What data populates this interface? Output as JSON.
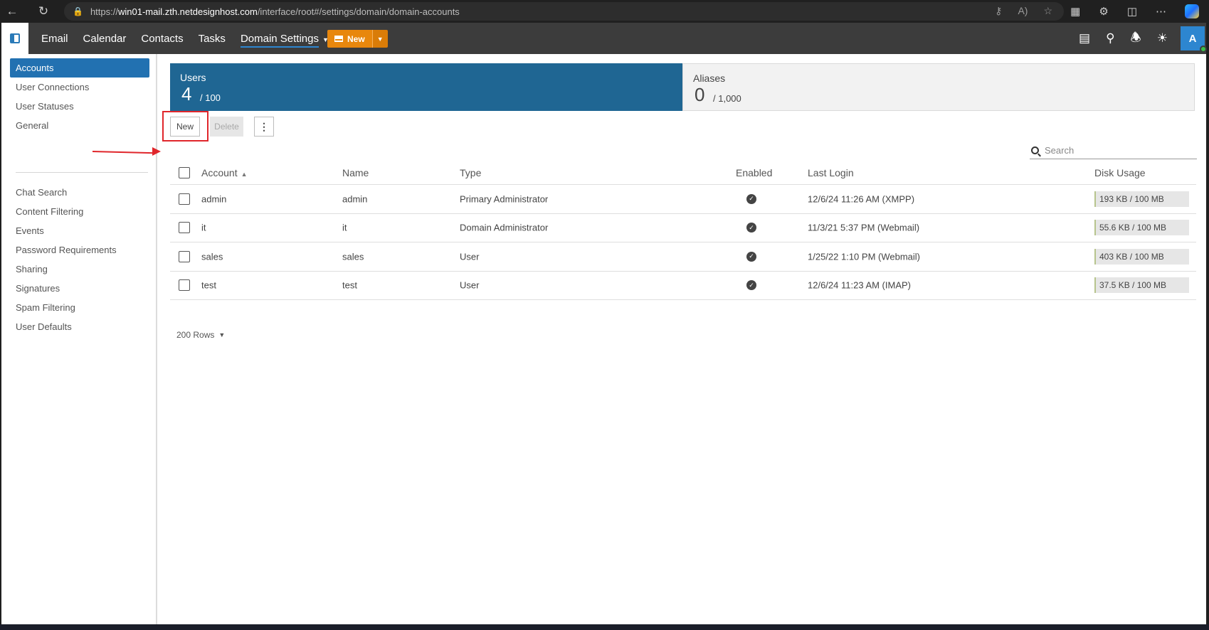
{
  "browser": {
    "url_prefix": "https://",
    "url_host": "win01-mail.zth.netdesignhost.com",
    "url_path": "/interface/root#/settings/domain/domain-accounts"
  },
  "topnav": {
    "links": [
      "Email",
      "Calendar",
      "Contacts",
      "Tasks"
    ],
    "active_link": "Domain Settings",
    "new_button": "New",
    "avatar_initial": "A"
  },
  "sidebar": {
    "items": [
      "Accounts",
      "User Connections",
      "User Statuses",
      "General",
      "Chat Search",
      "Content Filtering",
      "Events",
      "Password Requirements",
      "Sharing",
      "Signatures",
      "Spam Filtering",
      "User Defaults"
    ],
    "active_index": 0
  },
  "stats": {
    "users": {
      "label": "Users",
      "count": "4",
      "max": "/ 100"
    },
    "aliases": {
      "label": "Aliases",
      "count": "0",
      "max": "/ 1,000"
    }
  },
  "toolbar": {
    "new_label": "New",
    "delete_label": "Delete",
    "search_placeholder": "Search"
  },
  "table": {
    "columns": {
      "account": "Account",
      "name": "Name",
      "type": "Type",
      "enabled": "Enabled",
      "last_login": "Last Login",
      "disk_usage": "Disk Usage"
    },
    "rows": [
      {
        "account": "admin",
        "name": "admin",
        "type": "Primary Administrator",
        "enabled": true,
        "last_login": "12/6/24 11:26 AM (XMPP)",
        "disk_usage": "193 KB / 100 MB"
      },
      {
        "account": "it",
        "name": "it",
        "type": "Domain Administrator",
        "enabled": true,
        "last_login": "11/3/21 5:37 PM (Webmail)",
        "disk_usage": "55.6 KB / 100 MB"
      },
      {
        "account": "sales",
        "name": "sales",
        "type": "User",
        "enabled": true,
        "last_login": "1/25/22 1:10 PM (Webmail)",
        "disk_usage": "403 KB / 100 MB"
      },
      {
        "account": "test",
        "name": "test",
        "type": "User",
        "enabled": true,
        "last_login": "12/6/24 11:23 AM (IMAP)",
        "disk_usage": "37.5 KB / 100 MB"
      }
    ]
  },
  "pagination": {
    "rows_label": "200 Rows"
  },
  "colors": {
    "accent": "#1f6693",
    "active_sidebar": "#2271b1",
    "new_button": "#e8870d",
    "annotation": "#e0262b"
  }
}
